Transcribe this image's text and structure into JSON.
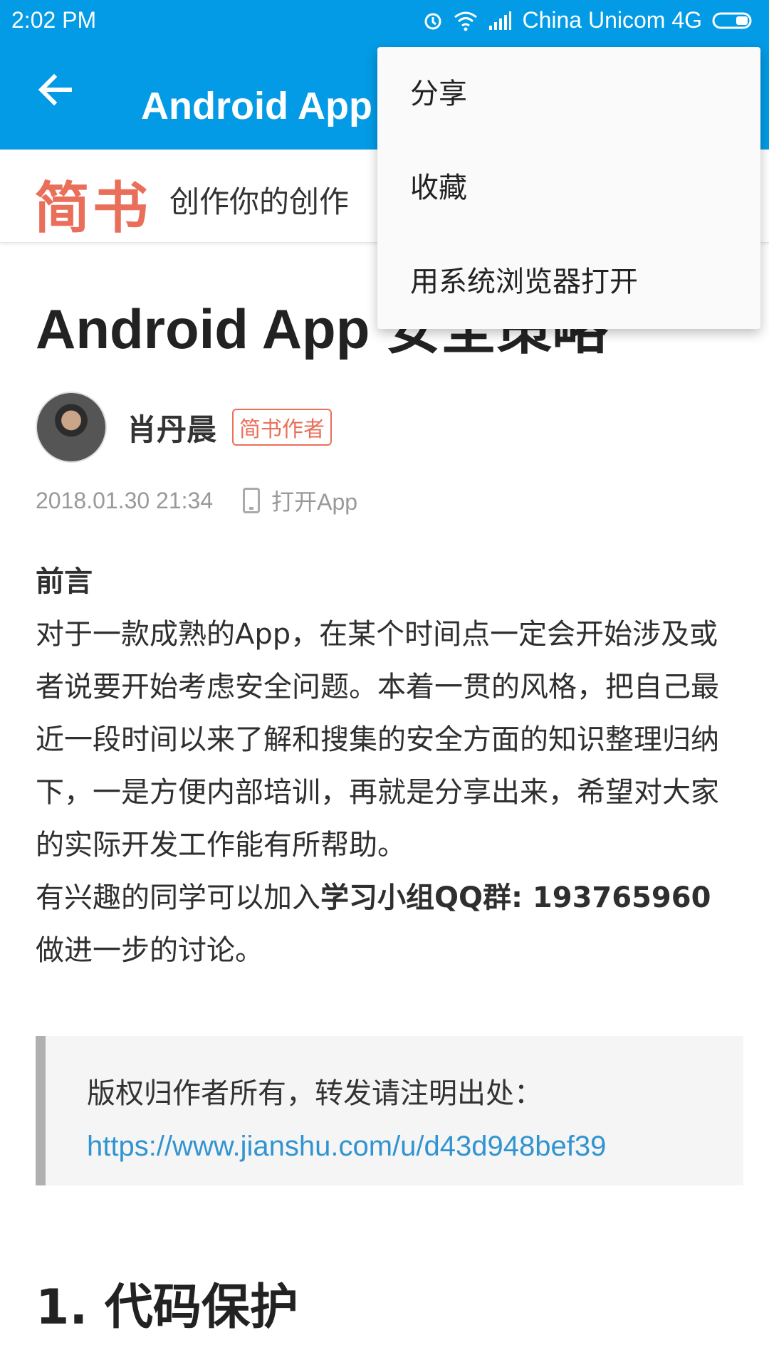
{
  "status_bar": {
    "time": "2:02 PM",
    "carrier": "China Unicom 4G",
    "icons": [
      "alarm-icon",
      "wifi-icon",
      "signal-icon",
      "battery-icon"
    ]
  },
  "app_bar": {
    "title": "Android App 安全策略",
    "back_icon": "arrow-back-icon"
  },
  "banner": {
    "logo": "简书",
    "slogan": "创作你的创作"
  },
  "article": {
    "title": "Android App 安全策略",
    "author": {
      "name": "肖丹晨",
      "badge": "简书作者"
    },
    "meta": {
      "date": "2018.01.30 21:34",
      "open_app": "打开App"
    },
    "section_label": "前言",
    "paragraph_1": "对于一款成熟的App，在某个时间点一定会开始涉及或者说要开始考虑安全问题。本着一贯的风格，把自己最近一段时间以来了解和搜集的安全方面的知识整理归纳下，一是方便内部培训，再就是分享出来，希望对大家的实际开发工作能有所帮助。",
    "paragraph_2_prefix": "有兴趣的同学可以加入",
    "paragraph_2_bold": "学习小组QQ群: 193765960",
    "paragraph_2_suffix": "做进一步的讨论。",
    "quote_text": "版权归作者所有，转发请注明出处：",
    "quote_link": "https://www.jianshu.com/u/d43d948bef39",
    "heading_1": "1. 代码保护"
  },
  "overflow_menu": {
    "items": [
      "分享",
      "收藏",
      "用系统浏览器打开"
    ]
  },
  "colors": {
    "primary": "#039BE5",
    "logo": "#EA6F5A",
    "link": "#3194d0"
  }
}
